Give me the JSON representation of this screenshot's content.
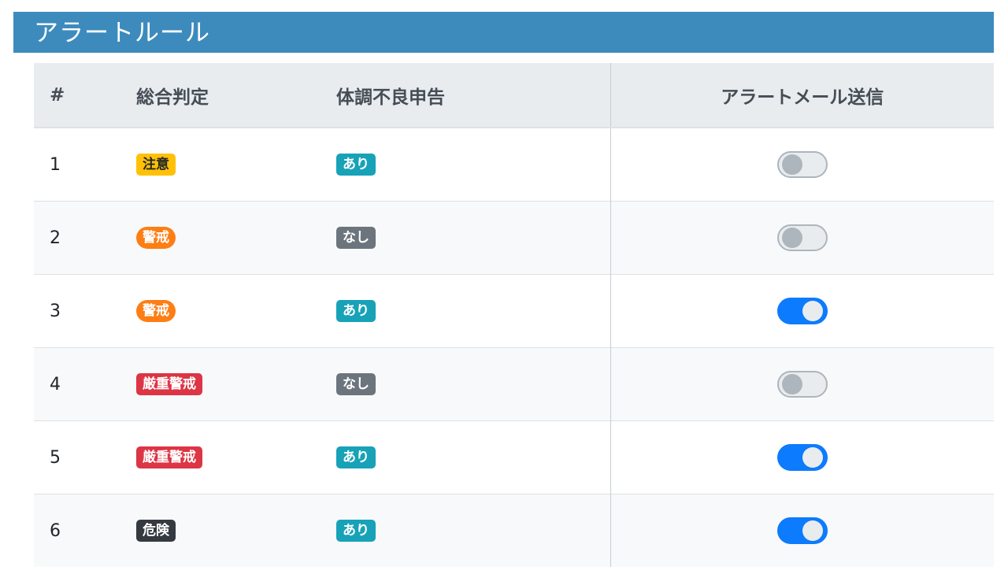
{
  "title": "アラートルール",
  "table": {
    "headers": [
      "#",
      "総合判定",
      "体調不良申告",
      "アラートメール送信"
    ],
    "rows": [
      {
        "num": "1",
        "judgement": "注意",
        "judgement_color": "#ffc107",
        "judgement_text_color": "#212529",
        "judgement_shape": "rect",
        "health": "あり",
        "health_color": "#17a2b8",
        "alert_mail": false
      },
      {
        "num": "2",
        "judgement": "警戒",
        "judgement_color": "#fd7e14",
        "judgement_text_color": "#ffffff",
        "judgement_shape": "pill",
        "health": "なし",
        "health_color": "#6c757d",
        "alert_mail": false
      },
      {
        "num": "3",
        "judgement": "警戒",
        "judgement_color": "#fd7e14",
        "judgement_text_color": "#ffffff",
        "judgement_shape": "pill",
        "health": "あり",
        "health_color": "#17a2b8",
        "alert_mail": true
      },
      {
        "num": "4",
        "judgement": "厳重警戒",
        "judgement_color": "#dc3545",
        "judgement_text_color": "#ffffff",
        "judgement_shape": "rect",
        "health": "なし",
        "health_color": "#6c757d",
        "alert_mail": false
      },
      {
        "num": "5",
        "judgement": "厳重警戒",
        "judgement_color": "#dc3545",
        "judgement_text_color": "#ffffff",
        "judgement_shape": "rect",
        "health": "あり",
        "health_color": "#17a2b8",
        "alert_mail": true
      },
      {
        "num": "6",
        "judgement": "危険",
        "judgement_color": "#343a40",
        "judgement_text_color": "#ffffff",
        "judgement_shape": "rect",
        "health": "あり",
        "health_color": "#17a2b8",
        "alert_mail": true
      }
    ]
  }
}
